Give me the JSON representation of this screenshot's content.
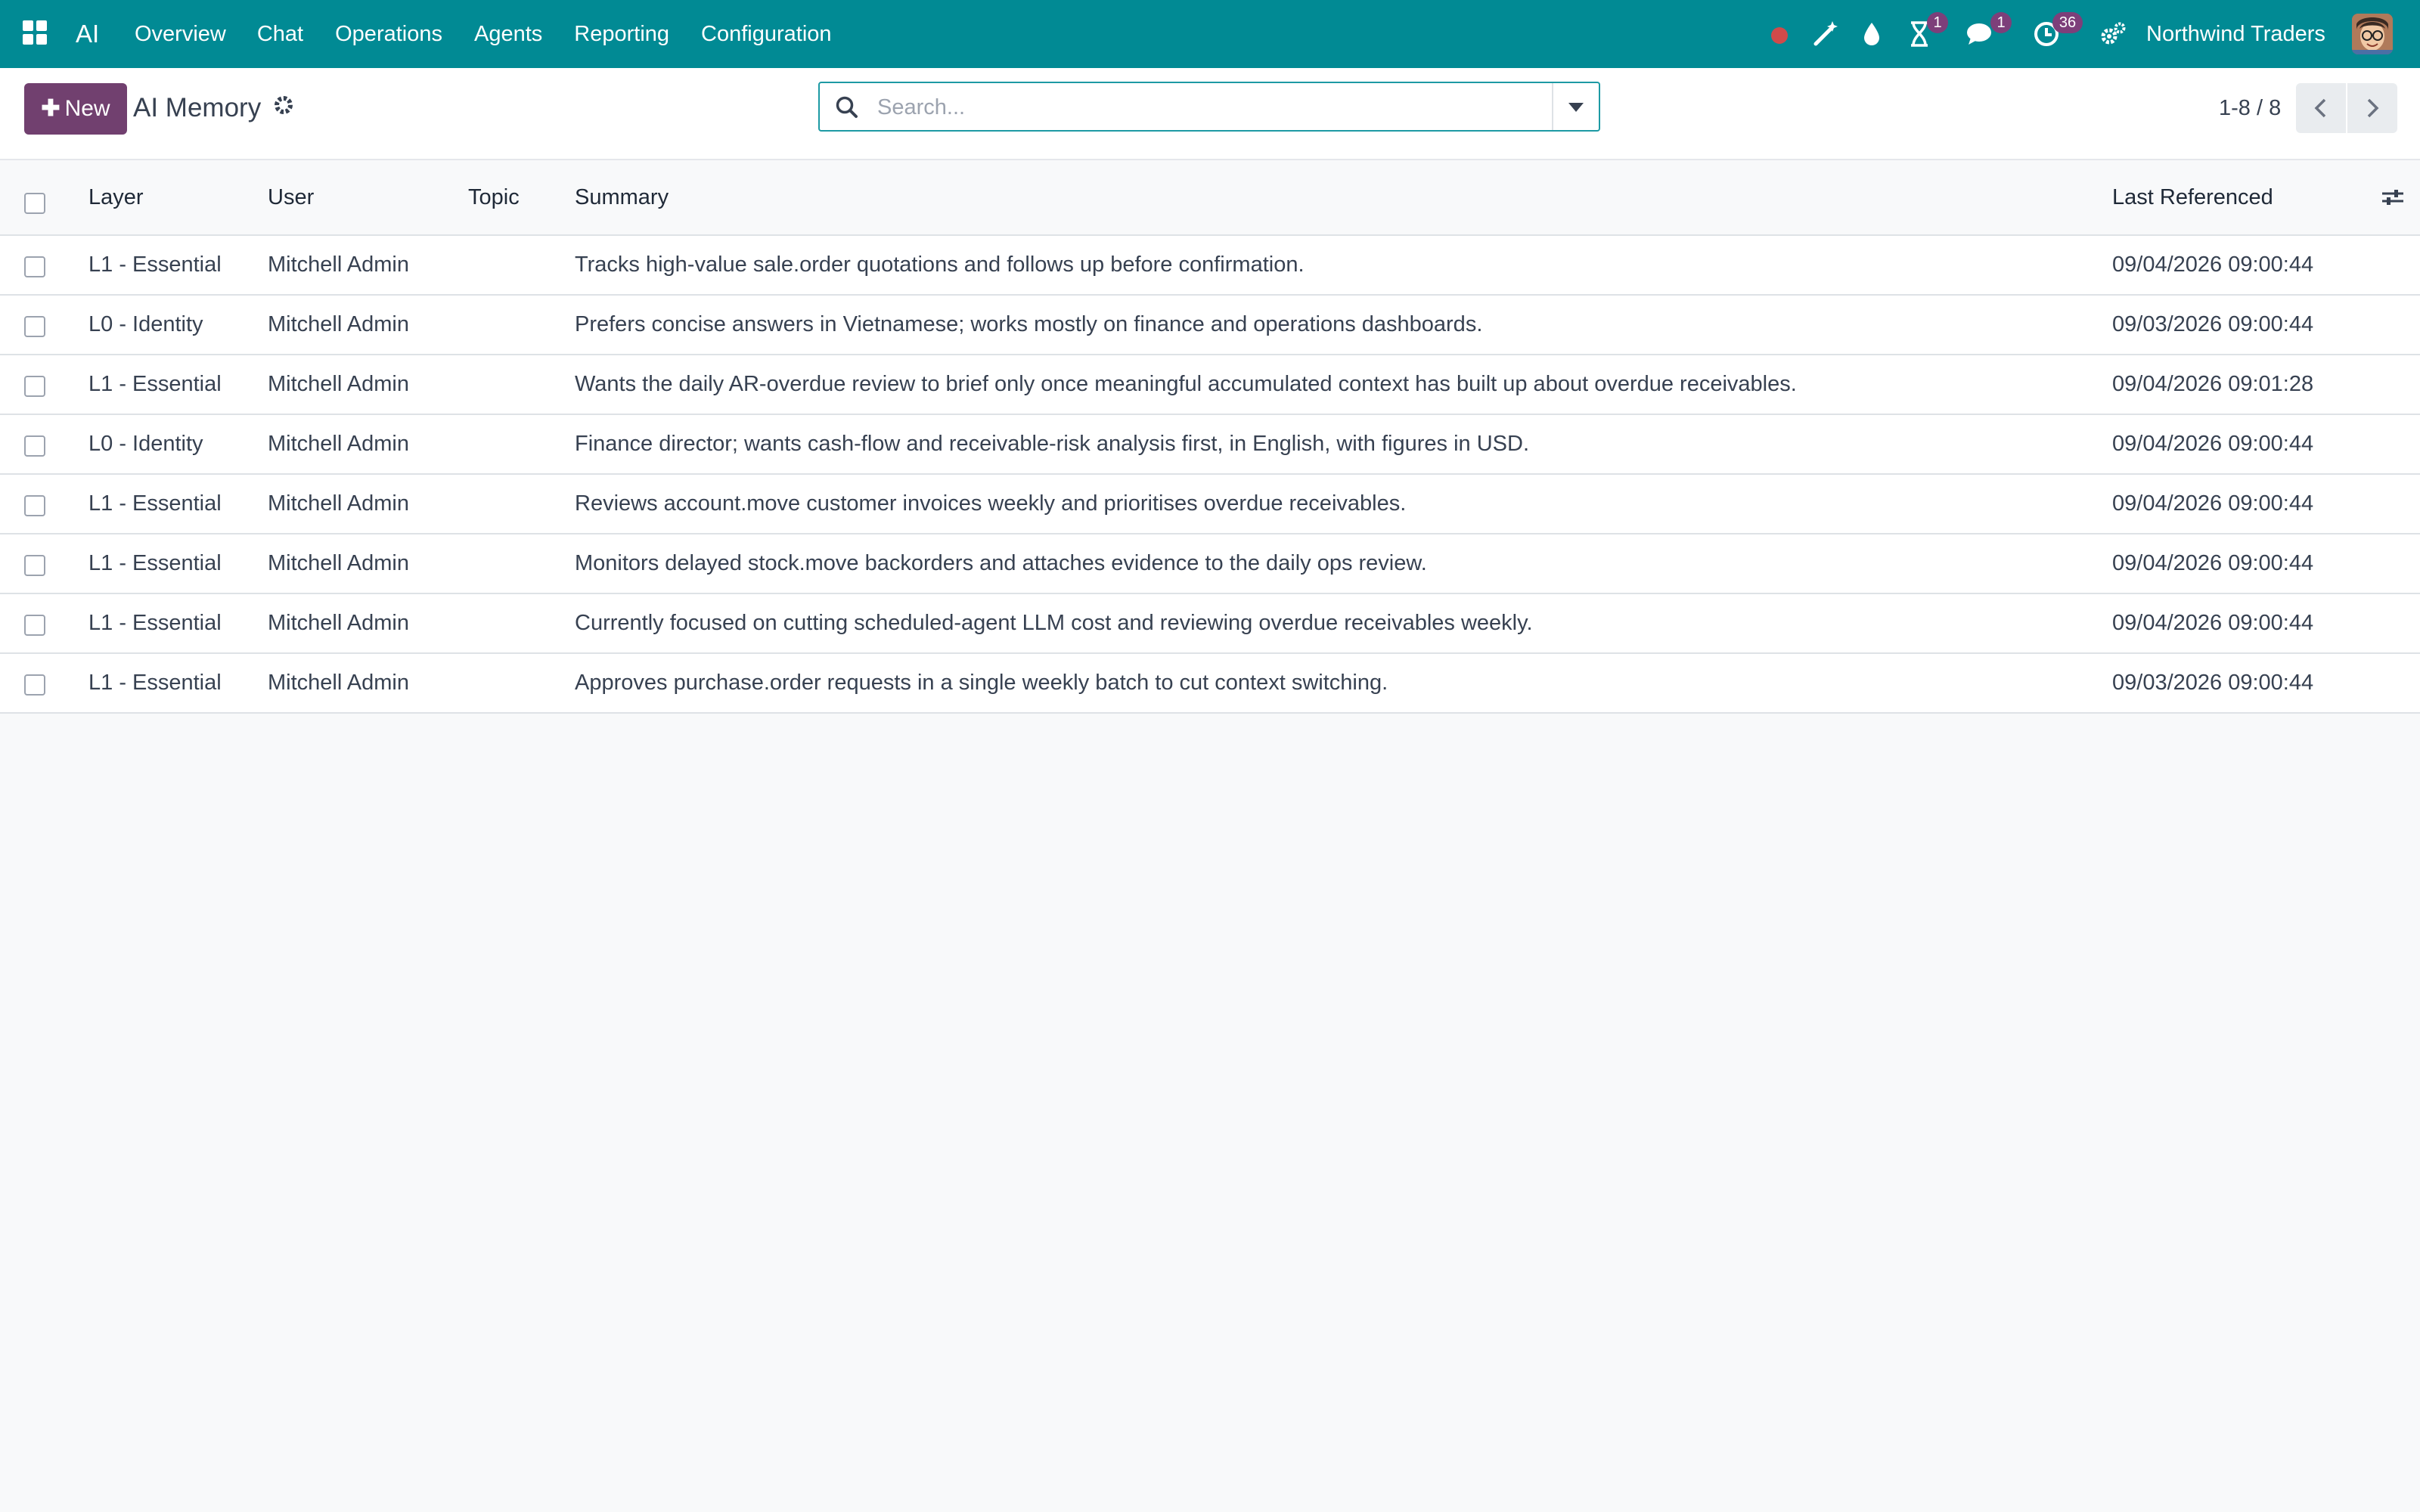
{
  "navbar": {
    "app_name": "AI",
    "menu": [
      "Overview",
      "Chat",
      "Operations",
      "Agents",
      "Reporting",
      "Configuration"
    ],
    "badges": {
      "activities": "1",
      "messages": "1",
      "clock": "36"
    },
    "company": "Northwind Traders",
    "color": "#018a94"
  },
  "control": {
    "new_label": "New",
    "title": "AI Memory",
    "search_placeholder": "Search...",
    "pager": "1-8 / 8"
  },
  "table": {
    "headers": {
      "layer": "Layer",
      "user": "User",
      "topic": "Topic",
      "summary": "Summary",
      "last_referenced": "Last Referenced"
    },
    "rows": [
      {
        "layer": "L1 - Essential",
        "user": "Mitchell Admin",
        "topic": "",
        "summary": "Tracks high-value sale.order quotations and follows up before confirmation.",
        "last_referenced": "09/04/2026 09:00:44"
      },
      {
        "layer": "L0 - Identity",
        "user": "Mitchell Admin",
        "topic": "",
        "summary": "Prefers concise answers in Vietnamese; works mostly on finance and operations dashboards.",
        "last_referenced": "09/03/2026 09:00:44"
      },
      {
        "layer": "L1 - Essential",
        "user": "Mitchell Admin",
        "topic": "",
        "summary": "Wants the daily AR-overdue review to brief only once meaningful accumulated context has built up about overdue receivables.",
        "last_referenced": "09/04/2026 09:01:28"
      },
      {
        "layer": "L0 - Identity",
        "user": "Mitchell Admin",
        "topic": "",
        "summary": "Finance director; wants cash-flow and receivable-risk analysis first, in English, with figures in USD.",
        "last_referenced": "09/04/2026 09:00:44"
      },
      {
        "layer": "L1 - Essential",
        "user": "Mitchell Admin",
        "topic": "",
        "summary": "Reviews account.move customer invoices weekly and prioritises overdue receivables.",
        "last_referenced": "09/04/2026 09:00:44"
      },
      {
        "layer": "L1 - Essential",
        "user": "Mitchell Admin",
        "topic": "",
        "summary": "Monitors delayed stock.move backorders and attaches evidence to the daily ops review.",
        "last_referenced": "09/04/2026 09:00:44"
      },
      {
        "layer": "L1 - Essential",
        "user": "Mitchell Admin",
        "topic": "",
        "summary": "Currently focused on cutting scheduled-agent LLM cost and reviewing overdue receivables weekly.",
        "last_referenced": "09/04/2026 09:00:44"
      },
      {
        "layer": "L1 - Essential",
        "user": "Mitchell Admin",
        "topic": "",
        "summary": "Approves purchase.order requests in a single weekly batch to cut context switching.",
        "last_referenced": "09/03/2026 09:00:44"
      }
    ]
  }
}
